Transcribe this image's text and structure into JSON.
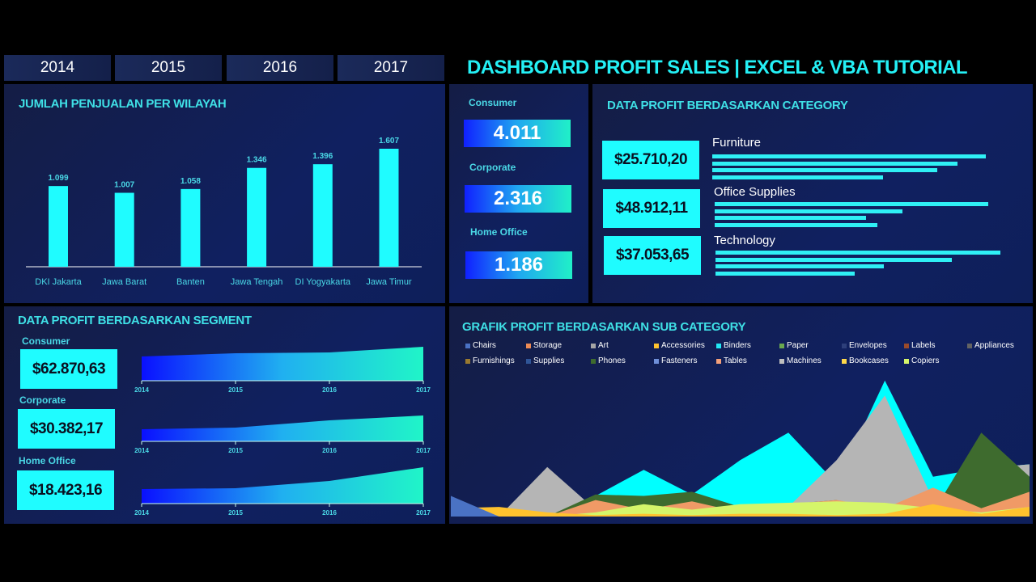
{
  "years": [
    "2014",
    "2015",
    "2016",
    "2017"
  ],
  "title": "DASHBOARD PROFIT SALES | EXCEL & VBA TUTORIAL",
  "region_panel": {
    "title": "JUMLAH PENJUALAN PER WILAYAH"
  },
  "segment_counts": [
    {
      "label": "Consumer",
      "value": "4.011"
    },
    {
      "label": "Corporate",
      "value": "2.316"
    },
    {
      "label": "Home Office",
      "value": "1.186"
    }
  ],
  "category_panel": {
    "title": "DATA PROFIT BERDASARKAN CATEGORY",
    "items": [
      {
        "name": "Furniture",
        "value": "$25.710,20",
        "bars_pct": [
          96,
          86,
          79,
          60
        ]
      },
      {
        "name": "Office Supplies",
        "value": "$48.912,11",
        "bars_pct": [
          96,
          66,
          53,
          57
        ]
      },
      {
        "name": "Technology",
        "value": "$37.053,65",
        "bars_pct": [
          100,
          83,
          59,
          49
        ]
      }
    ]
  },
  "segment_panel": {
    "title": "DATA PROFIT BERDASARKAN SEGMENT",
    "items": [
      {
        "label": "Consumer",
        "value": "$62.870,63"
      },
      {
        "label": "Corporate",
        "value": "$30.382,17"
      },
      {
        "label": "Home Office",
        "value": "$18.423,16"
      }
    ]
  },
  "subcat_panel": {
    "title": "GRAFIK PROFIT BERDASARKAN SUB CATEGORY"
  },
  "colors": {
    "accent": "#1ffcff",
    "bar": "#1ffcff",
    "title": "#24f0f5"
  },
  "chart_data": [
    {
      "type": "bar",
      "title": "JUMLAH PENJUALAN PER WILAYAH",
      "categories": [
        "DKI Jakarta",
        "Jawa Barat",
        "Banten",
        "Jawa Tengah",
        "DI Yogyakarta",
        "Jawa Timur"
      ],
      "values": [
        1099,
        1007,
        1058,
        1346,
        1396,
        1607
      ],
      "labels": [
        "1.099",
        "1.007",
        "1.058",
        "1.346",
        "1.396",
        "1.607"
      ],
      "ylim": [
        0,
        1607
      ],
      "grid": false
    },
    {
      "type": "area",
      "title": "DATA PROFIT BERDASARKAN SEGMENT",
      "categories": [
        "2014",
        "2015",
        "2016",
        "2017"
      ],
      "series": [
        {
          "name": "Consumer",
          "values": [
            30,
            34,
            35,
            42
          ]
        },
        {
          "name": "Corporate",
          "values": [
            15,
            17,
            26,
            32
          ]
        },
        {
          "name": "Home Office",
          "values": [
            18,
            19,
            28,
            45
          ]
        }
      ],
      "grid": false
    },
    {
      "type": "area",
      "title": "GRAFIK PROFIT BERDASARKAN SUB CATEGORY",
      "legend": "top",
      "legend_items": [
        {
          "name": "Chairs",
          "color": "#4a72c4"
        },
        {
          "name": "Storage",
          "color": "#ed8b55"
        },
        {
          "name": "Art",
          "color": "#a5a5a5"
        },
        {
          "name": "Accessories",
          "color": "#ffc22e"
        },
        {
          "name": "Binders",
          "color": "#22e8f5"
        },
        {
          "name": "Paper",
          "color": "#6aa84f"
        },
        {
          "name": "Envelopes",
          "color": "#2d3f7a"
        },
        {
          "name": "Labels",
          "color": "#9a4a2a"
        },
        {
          "name": "Appliances",
          "color": "#636363"
        },
        {
          "name": "Furnishings",
          "color": "#9a7a30"
        },
        {
          "name": "Supplies",
          "color": "#2f5597"
        },
        {
          "name": "Phones",
          "color": "#3e6b2e"
        },
        {
          "name": "Fasteners",
          "color": "#6f8fd8"
        },
        {
          "name": "Tables",
          "color": "#f4a07a"
        },
        {
          "name": "Machines",
          "color": "#bfbfbf"
        },
        {
          "name": "Bookcases",
          "color": "#ffd84a"
        },
        {
          "name": "Copiers",
          "color": "#d5f56a"
        }
      ],
      "series": [
        {
          "name": "Binders",
          "color": "#00ffff",
          "values": [
            0,
            0,
            0,
            15,
            34,
            16,
            41,
            61,
            24,
            99,
            29,
            35,
            38
          ]
        },
        {
          "name": "Machines",
          "color": "#b5b5b5",
          "values": [
            0,
            0,
            36,
            5,
            12,
            6,
            3,
            7,
            41,
            88,
            12,
            35,
            38
          ]
        },
        {
          "name": "Phones",
          "color": "#3e6b2e",
          "values": [
            5,
            0,
            0,
            16,
            15,
            18,
            7,
            9,
            12,
            0,
            3,
            61,
            29
          ]
        },
        {
          "name": "Tables",
          "color": "#f09a66",
          "values": [
            0,
            0,
            0,
            12,
            5,
            11,
            3,
            9,
            12,
            6,
            21,
            6,
            18
          ]
        },
        {
          "name": "Copiers",
          "color": "#d5f56a",
          "values": [
            0,
            0,
            0,
            3,
            9,
            5,
            9,
            10,
            11,
            10,
            6,
            3,
            7
          ]
        },
        {
          "name": "Accessories",
          "color": "#ffc22e",
          "values": [
            6,
            7,
            3,
            1,
            2,
            1,
            2,
            2,
            1,
            2,
            9,
            2,
            7
          ]
        },
        {
          "name": "Chairs",
          "color": "#4a72c4",
          "values": [
            15,
            0,
            0,
            0,
            0,
            0,
            0,
            0,
            0,
            0,
            0,
            0,
            0
          ]
        }
      ],
      "grid": false
    }
  ]
}
